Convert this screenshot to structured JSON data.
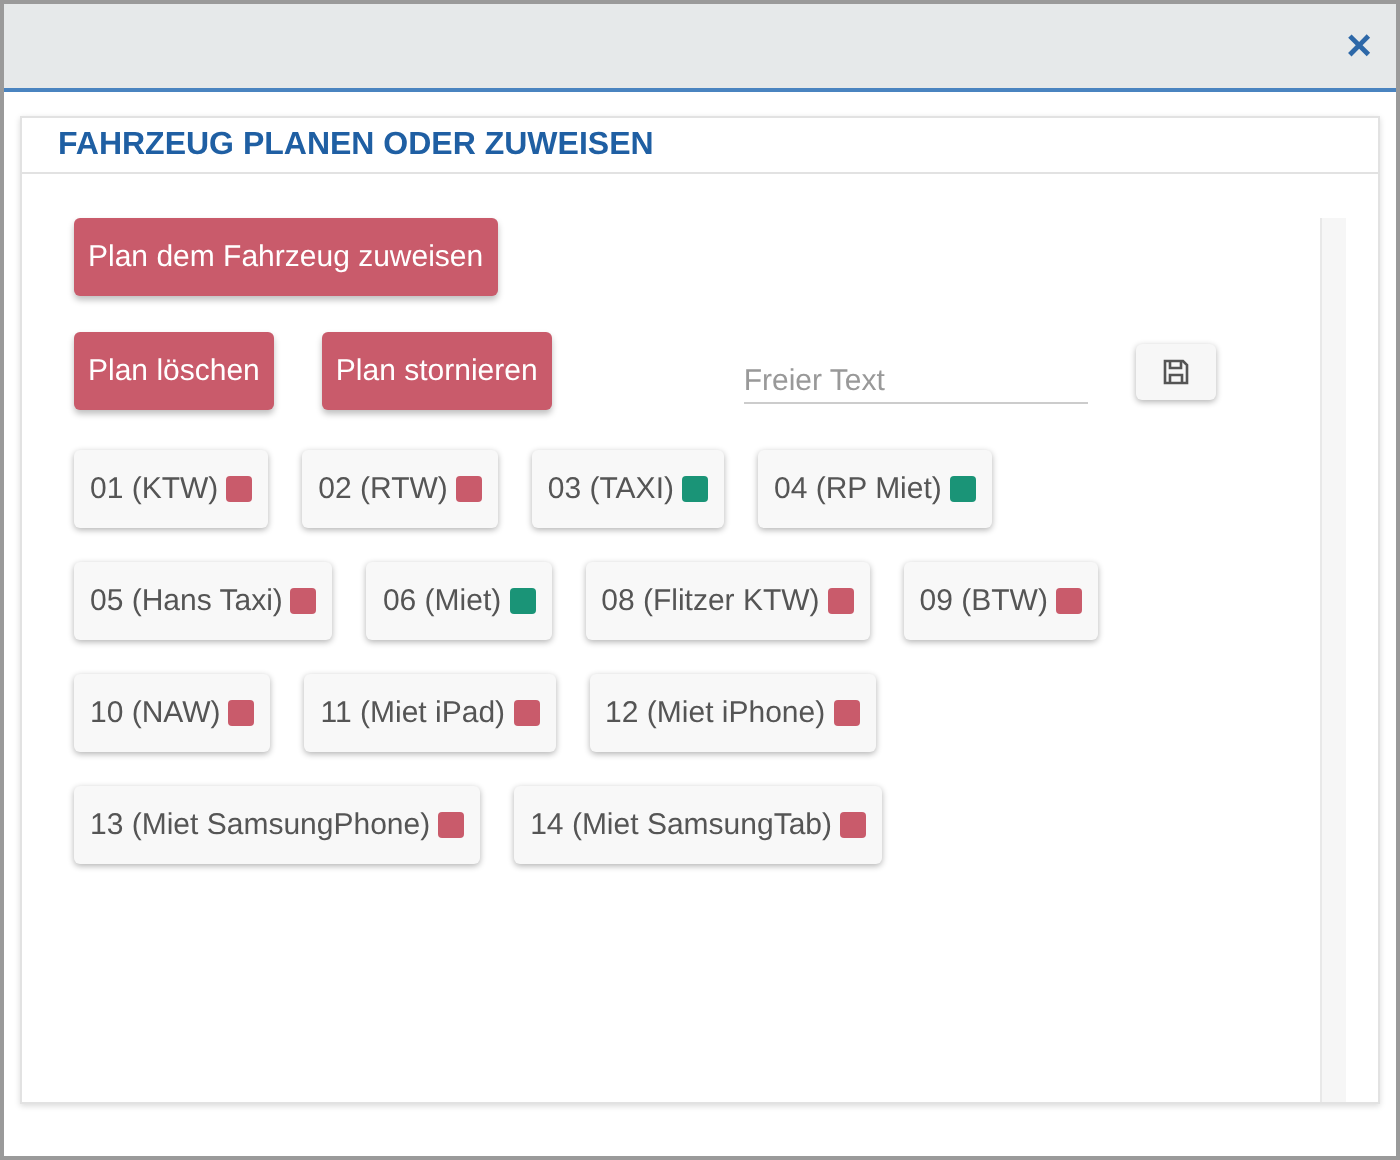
{
  "dialog": {
    "close": "×",
    "title": "FAHRZEUG PLANEN ODER ZUWEISEN"
  },
  "actions": {
    "assign": "Plan dem Fahrzeug zuweisen",
    "delete": "Plan löschen",
    "cancel": "Plan stornieren"
  },
  "free_text": {
    "placeholder": "Freier Text"
  },
  "vehicle_rows": [
    [
      {
        "label": "01 (KTW)",
        "color": "#c95b6b"
      },
      {
        "label": "02 (RTW)",
        "color": "#c95b6b"
      },
      {
        "label": "03 (TAXI)",
        "color": "#1a9477"
      },
      {
        "label": "04 (RP Miet)",
        "color": "#1a9477"
      }
    ],
    [
      {
        "label": "05 (Hans Taxi)",
        "color": "#c95b6b"
      },
      {
        "label": "06 (Miet)",
        "color": "#1a9477"
      },
      {
        "label": "08 (Flitzer KTW)",
        "color": "#c95b6b"
      },
      {
        "label": "09 (BTW)",
        "color": "#c95b6b"
      }
    ],
    [
      {
        "label": "10 (NAW)",
        "color": "#c95b6b"
      },
      {
        "label": "11 (Miet iPad)",
        "color": "#c95b6b"
      },
      {
        "label": "12 (Miet iPhone)",
        "color": "#c95b6b"
      }
    ],
    [
      {
        "label": "13 (Miet SamsungPhone)",
        "color": "#c95b6b"
      },
      {
        "label": "14 (Miet SamsungTab)",
        "color": "#c95b6b"
      }
    ]
  ]
}
